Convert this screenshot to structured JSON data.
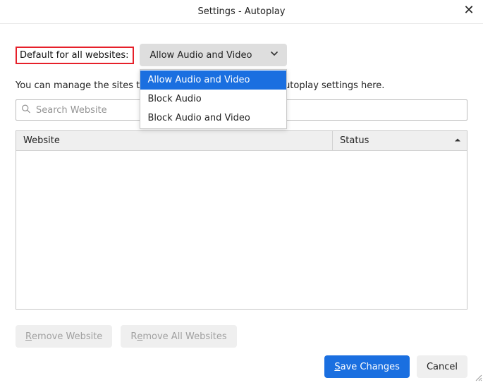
{
  "title": "Settings - Autoplay",
  "default_label": "Default for all websites:",
  "default_select": {
    "current": "Allow Audio and Video",
    "options": [
      "Allow Audio and Video",
      "Block Audio",
      "Block Audio and Video"
    ]
  },
  "manage_text_pre": "You can manage the sites",
  "manage_text_mid": " that do not follow your default aut",
  "manage_text_post": "oplay settings here.",
  "search_placeholder": "Search Website",
  "columns": {
    "website": "Website",
    "status": "Status"
  },
  "buttons": {
    "remove": {
      "accesskey": "R",
      "rest": "emove Website"
    },
    "remove_all": {
      "pre": "R",
      "accesskey": "e",
      "rest": "move All Websites"
    },
    "save": {
      "accesskey": "S",
      "rest": "ave Changes"
    },
    "cancel": "Cancel"
  }
}
